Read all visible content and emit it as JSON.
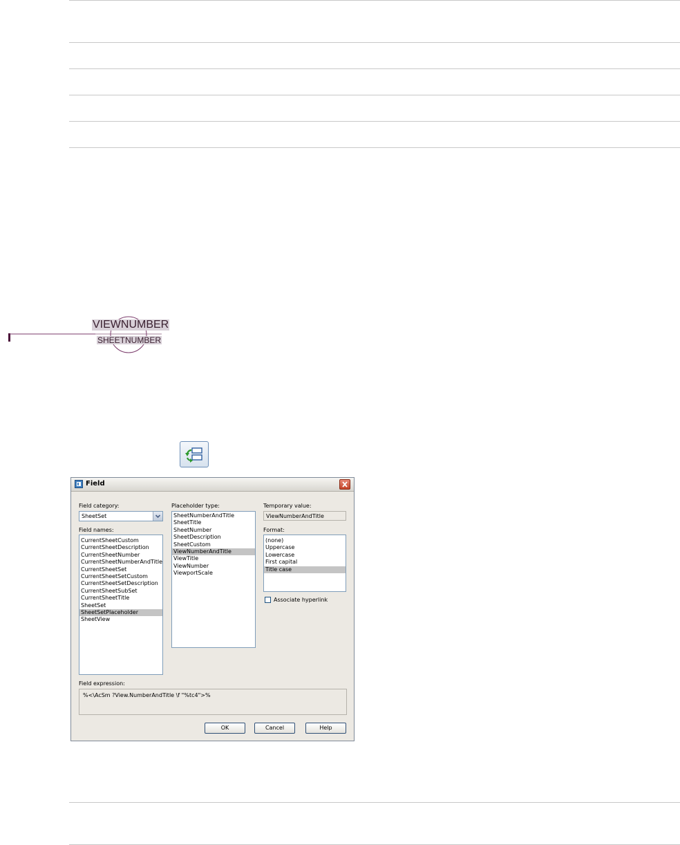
{
  "callout": {
    "top_label": "VIEWNUMBER",
    "bottom_label": "SHEETNUMBER"
  },
  "toolbar": {
    "update_icon": "update-fields-icon"
  },
  "dialog": {
    "title": "Field",
    "field_category": {
      "label": "Field category:",
      "value": "SheetSet"
    },
    "field_names": {
      "label": "Field names:",
      "items": [
        "CurrentSheetCustom",
        "CurrentSheetDescription",
        "CurrentSheetNumber",
        "CurrentSheetNumberAndTitle",
        "CurrentSheetSet",
        "CurrentSheetSetCustom",
        "CurrentSheetSetDescription",
        "CurrentSheetSubSet",
        "CurrentSheetTitle",
        "SheetSet",
        "SheetSetPlaceholder",
        "SheetView"
      ],
      "selected": "SheetSetPlaceholder"
    },
    "placeholder_type": {
      "label": "Placeholder type:",
      "items": [
        "SheetNumberAndTitle",
        "SheetTitle",
        "SheetNumber",
        "SheetDescription",
        "SheetCustom",
        "ViewNumberAndTitle",
        "ViewTitle",
        "ViewNumber",
        "ViewportScale"
      ],
      "selected": "ViewNumberAndTitle"
    },
    "temporary_value": {
      "label": "Temporary value:",
      "value": "ViewNumberAndTitle"
    },
    "format": {
      "label": "Format:",
      "items": [
        "(none)",
        "Uppercase",
        "Lowercase",
        "First capital",
        "Title case"
      ],
      "selected": "Title case"
    },
    "hyperlink_label": "Associate hyperlink",
    "field_expression": {
      "label": "Field expression:",
      "value": "%<\\AcSm ?View.NumberAndTitle \\f \"%tc4\">%"
    },
    "buttons": {
      "ok": "OK",
      "cancel": "Cancel",
      "help": "Help"
    }
  }
}
